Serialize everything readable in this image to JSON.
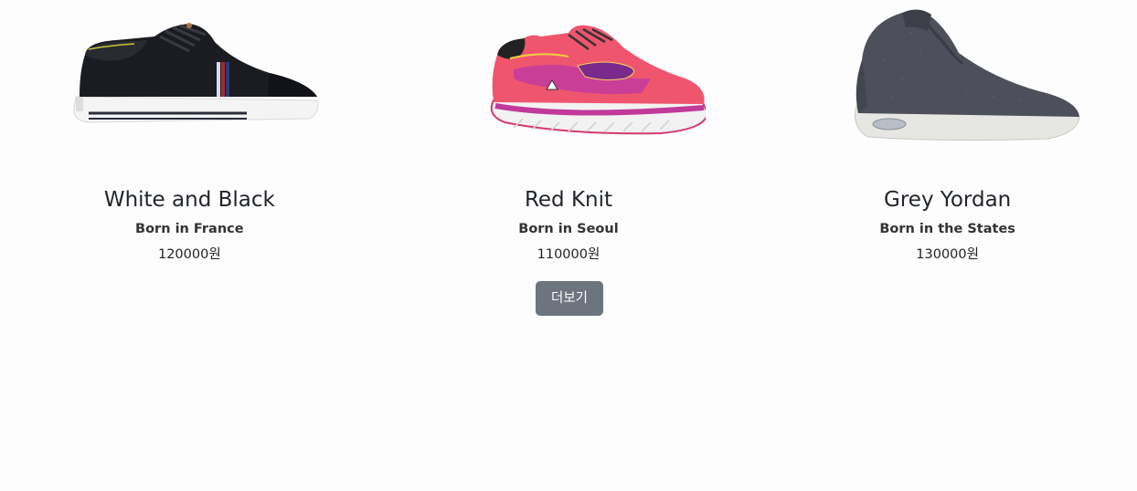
{
  "products": [
    {
      "image_icon": "black-sneaker-image",
      "title": "White and Black",
      "origin": "Born in France",
      "price": "120000원"
    },
    {
      "image_icon": "pink-running-shoe-image",
      "title": "Red Knit",
      "origin": "Born in Seoul",
      "price": "110000원"
    },
    {
      "image_icon": "grey-high-top-sneaker-image",
      "title": "Grey Yordan",
      "origin": "Born in the States",
      "price": "130000원"
    }
  ],
  "more_button_label": "더보기",
  "colors": {
    "background": "#fdfdfd",
    "button": "#6c757d",
    "button_text": "#ffffff"
  }
}
